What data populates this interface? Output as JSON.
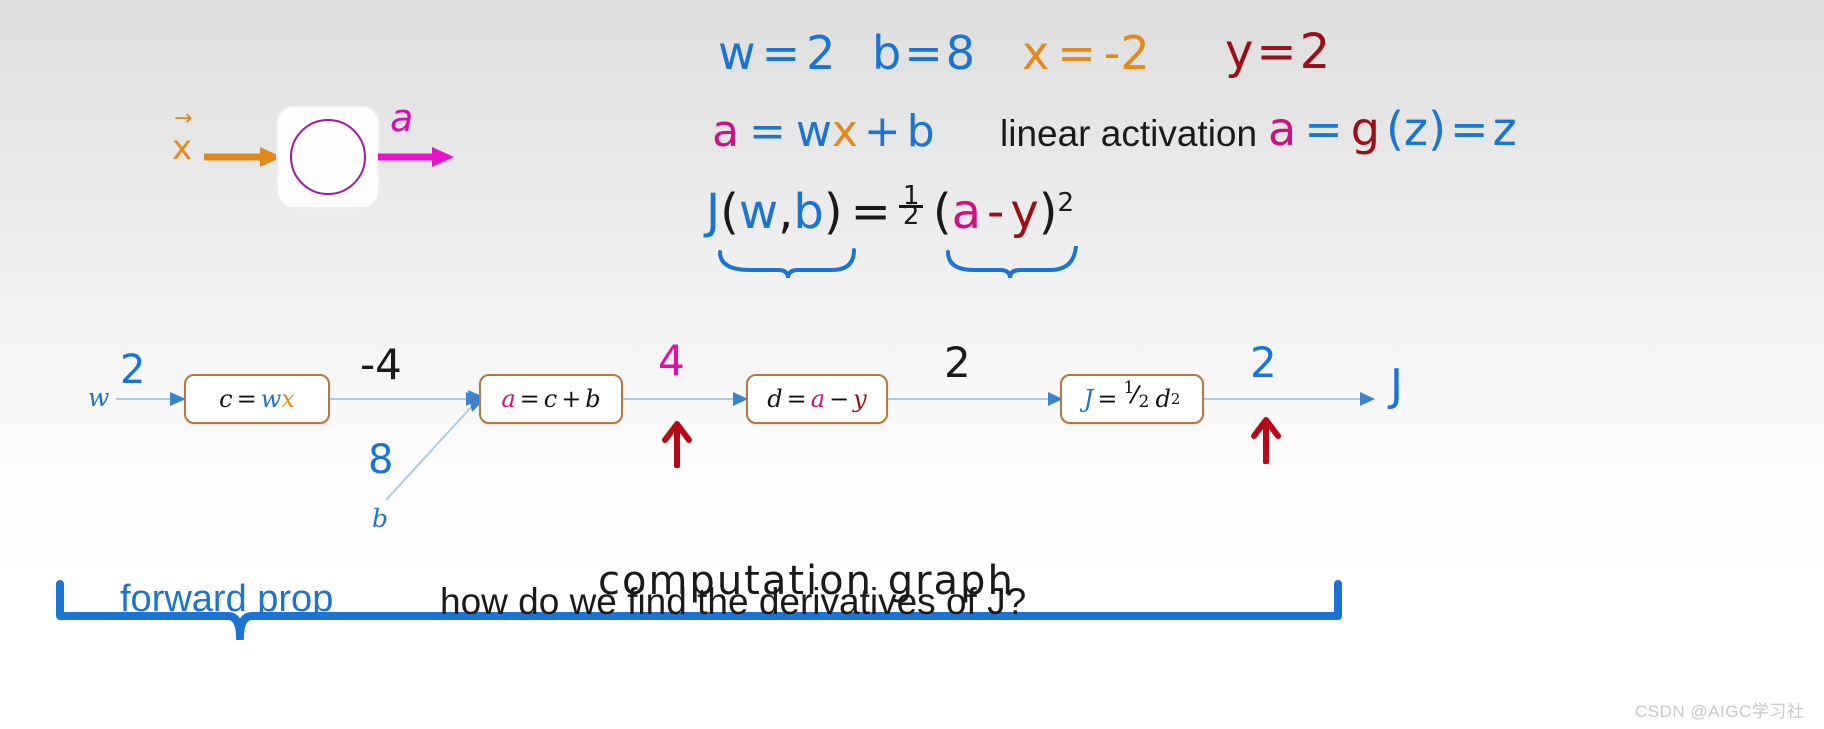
{
  "slide": {
    "title_region": "neural network derivative / computation graph lecture slide",
    "watermark": "CSDN @AIGC学习社"
  },
  "colors": {
    "blue": "#1b74d4",
    "orange": "#e08a1e",
    "dark_red": "#9d0f16",
    "magenta": "#cc1283",
    "purple": "#a317a3",
    "black": "#1a1a1a",
    "node_border": "#b5793a",
    "wire": "#a9cbe8"
  },
  "network": {
    "input_label": "x",
    "input_vector_arrow": "→",
    "output_label": "a",
    "neuron_icon": "circle-neuron-icon"
  },
  "givens": {
    "w": {
      "lhs": "w",
      "eq": "=",
      "rhs": "2"
    },
    "b": {
      "lhs": "b",
      "eq": "=",
      "rhs": "8"
    },
    "x": {
      "lhs": "x",
      "eq": "=",
      "rhs": "-2"
    },
    "y": {
      "lhs": "y",
      "eq": "=",
      "rhs": "2"
    }
  },
  "equations": {
    "forward": {
      "a": "a",
      "eq": "=",
      "w": "w",
      "x": "x",
      "plus": "+",
      "b": "b"
    },
    "activation_note": "linear activation",
    "activation": {
      "a": "a",
      "eq1": "=",
      "g": "g",
      "open": "(",
      "z": "z",
      "close": ")",
      "eq2": "=",
      "z2": "z"
    },
    "cost": {
      "J": "J",
      "open": "(",
      "w": "w",
      "comma": ",",
      "b": "b",
      "close": ")",
      "eq": "=",
      "half_num": "1",
      "half_den": "2",
      "p_open": "(",
      "a": "a",
      "minus": "-",
      "y": "y",
      "p_close": ")",
      "sq": "2"
    }
  },
  "graph": {
    "inputs": [
      {
        "name": "w",
        "label": "w",
        "value": "2"
      },
      {
        "name": "b",
        "label": "b",
        "value": "8"
      }
    ],
    "nodes": [
      {
        "id": "c",
        "lhs": "c",
        "eq": "=",
        "rhs_a": "w",
        "rhs_b": "x",
        "expr": "c = wx",
        "out_value": "-4"
      },
      {
        "id": "a",
        "lhs": "a",
        "eq": "=",
        "rhs_a": "c",
        "op": "+",
        "rhs_b": "b",
        "expr": "a = c + b",
        "out_value": "4"
      },
      {
        "id": "d",
        "lhs": "d",
        "eq": "=",
        "rhs_a": "a",
        "op": "−",
        "rhs_b": "y",
        "expr": "d = a − y",
        "out_value": "2"
      },
      {
        "id": "J",
        "lhs": "J",
        "eq": "=",
        "frac_num": "1",
        "frac_den": "2",
        "var": "d",
        "sup": "2",
        "expr": "J = 1/2 d²",
        "out_value": "2"
      }
    ],
    "final_output_label": "J",
    "caption": "computation graph",
    "bracket_label": "forward prop",
    "question": "how do we find the derivatives of J?"
  },
  "annotations": {
    "arrow_up_1": "up-arrow-icon",
    "arrow_up_2": "up-arrow-icon",
    "brace_cost_left": "underbrace",
    "brace_cost_right": "underbrace",
    "forward_prop_brace": "large-underbrace"
  }
}
